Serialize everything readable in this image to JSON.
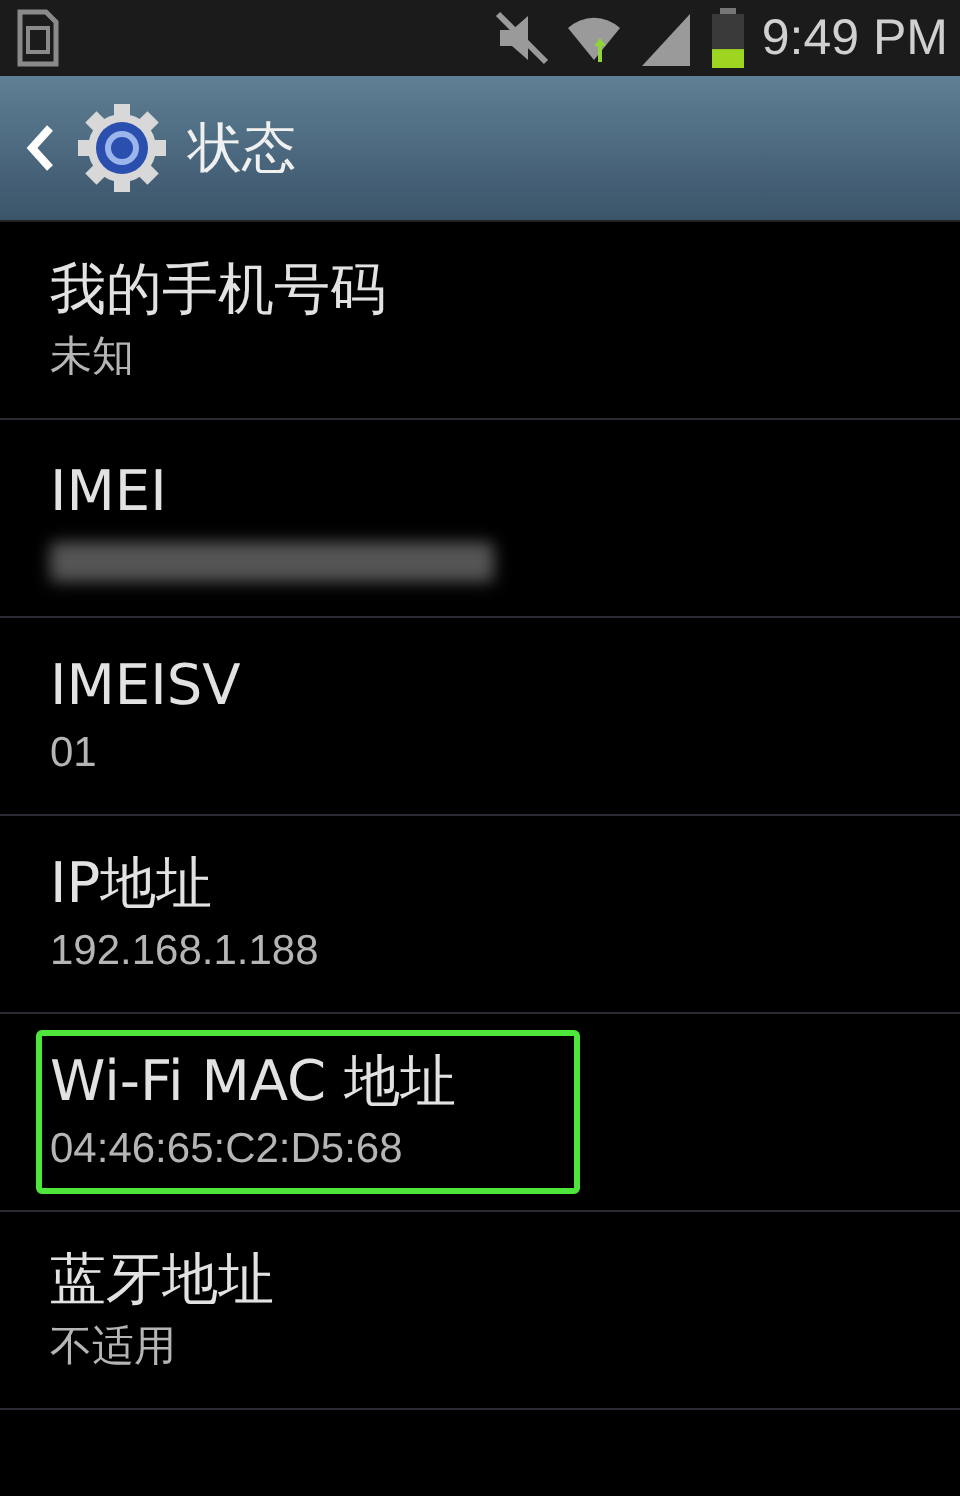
{
  "status_bar": {
    "time": "9:49 PM"
  },
  "action_bar": {
    "title": "状态"
  },
  "items": [
    {
      "title": "我的手机号码",
      "value": "未知",
      "redacted": false,
      "highlighted": false
    },
    {
      "title": "IMEI",
      "redacted": true,
      "highlighted": false
    },
    {
      "title": "IMEISV",
      "value": "01",
      "redacted": false,
      "highlighted": false
    },
    {
      "title": "IP地址",
      "value": "192.168.1.188",
      "redacted": false,
      "highlighted": false
    },
    {
      "title": "Wi-Fi MAC 地址",
      "value": "04:46:65:C2:D5:68",
      "redacted": false,
      "highlighted": true
    },
    {
      "title": "蓝牙地址",
      "value": "不适用",
      "redacted": false,
      "highlighted": false
    }
  ]
}
